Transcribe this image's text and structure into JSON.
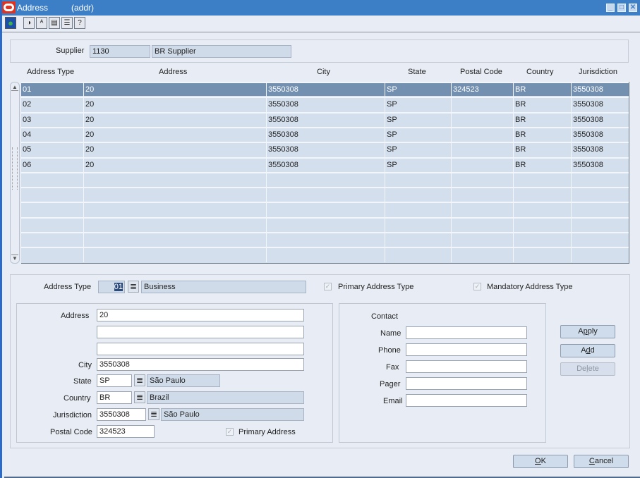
{
  "window": {
    "title": "Address",
    "code": "(addr)",
    "controls": [
      "minimize",
      "maximize",
      "close"
    ]
  },
  "toolbar": {
    "icons": [
      {
        "name": "globe-icon",
        "glyph": "●"
      },
      {
        "name": "refresh-icon",
        "glyph": "◑"
      },
      {
        "name": "spell-check-icon",
        "glyph": "ᴬ"
      },
      {
        "name": "document-icon",
        "glyph": "▤"
      },
      {
        "name": "notes-icon",
        "glyph": "☰"
      },
      {
        "name": "help-icon",
        "glyph": "?"
      }
    ]
  },
  "supplier": {
    "label": "Supplier",
    "id": "1130",
    "name": "BR Supplier"
  },
  "grid": {
    "headers": [
      "Address Type",
      "Address",
      "City",
      "State",
      "Postal Code",
      "Country",
      "Jurisdiction"
    ],
    "rows": [
      [
        "01",
        "20",
        "3550308",
        "SP",
        "324523",
        "BR",
        "3550308"
      ],
      [
        "02",
        "20",
        "3550308",
        "SP",
        "",
        "BR",
        "3550308"
      ],
      [
        "03",
        "20",
        "3550308",
        "SP",
        "",
        "BR",
        "3550308"
      ],
      [
        "04",
        "20",
        "3550308",
        "SP",
        "",
        "BR",
        "3550308"
      ],
      [
        "05",
        "20",
        "3550308",
        "SP",
        "",
        "BR",
        "3550308"
      ],
      [
        "06",
        "20",
        "3550308",
        "SP",
        "",
        "BR",
        "3550308"
      ]
    ],
    "empty_rows": 6,
    "selected_row": 0
  },
  "detail": {
    "address_type_label": "Address Type",
    "address_type_code": "01",
    "address_type_desc": "Business",
    "primary_address_type_label": "Primary Address Type",
    "primary_address_type_checked": true,
    "mandatory_address_type_label": "Mandatory Address Type",
    "mandatory_address_type_checked": true,
    "address_label": "Address",
    "address_line1": "20",
    "address_line2": "",
    "address_line3": "",
    "city_label": "City",
    "city": "3550308",
    "state_label": "State",
    "state_code": "SP",
    "state_desc": "São Paulo",
    "country_label": "Country",
    "country_code": "BR",
    "country_desc": "Brazil",
    "jurisdiction_label": "Jurisdiction",
    "jurisdiction_code": "3550308",
    "jurisdiction_desc": "São Paulo",
    "postal_code_label": "Postal Code",
    "postal_code": "324523",
    "primary_address_label": "Primary Address",
    "primary_address_checked": true
  },
  "contact": {
    "heading": "Contact",
    "name_label": "Name",
    "name": "",
    "phone_label": "Phone",
    "phone": "",
    "fax_label": "Fax",
    "fax": "",
    "pager_label": "Pager",
    "pager": "",
    "email_label": "Email",
    "email": ""
  },
  "actions": {
    "apply": {
      "pre": "A",
      "key": "p",
      "post": "ply"
    },
    "add": {
      "pre": "A",
      "key": "d",
      "post": "d"
    },
    "delete": {
      "pre": "De",
      "key": "l",
      "post": "ete"
    },
    "ok": {
      "pre": "",
      "key": "O",
      "post": "K"
    },
    "cancel": {
      "pre": "",
      "key": "C",
      "post": "ancel"
    }
  }
}
